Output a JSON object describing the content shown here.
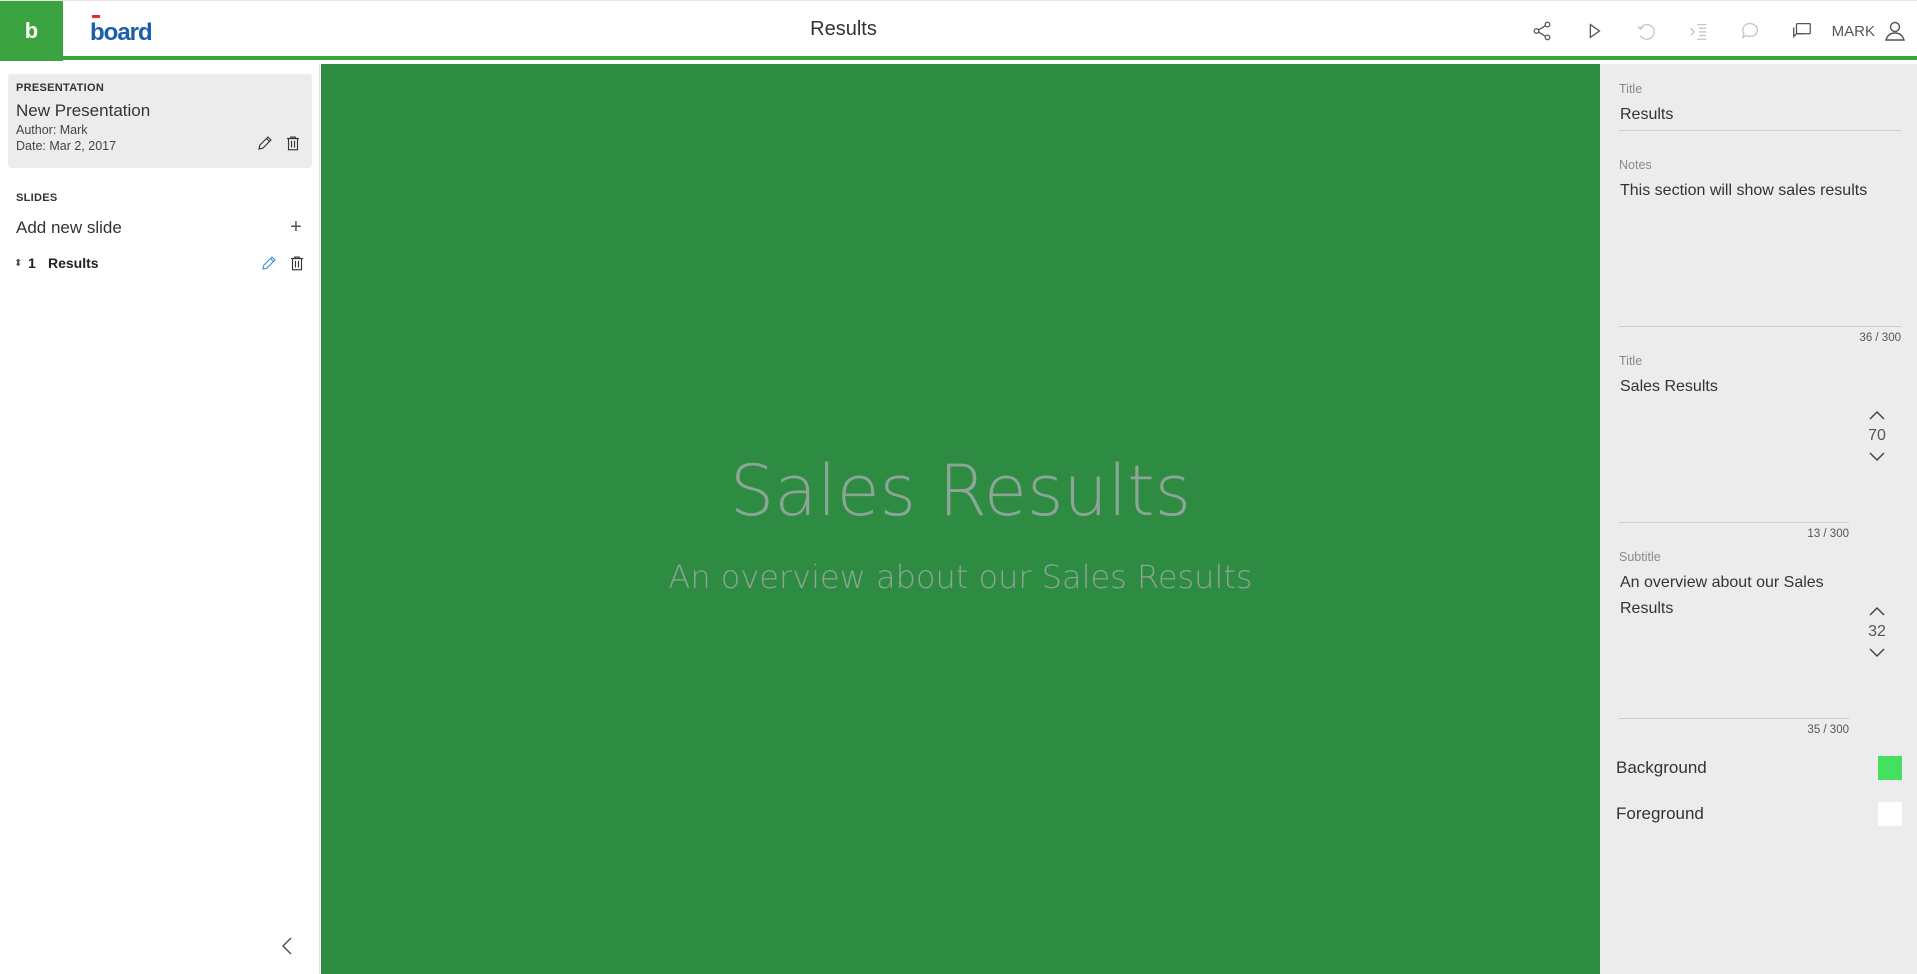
{
  "brand": {
    "square_letter": "b",
    "logo_text": "board"
  },
  "header": {
    "title": "Results",
    "user": "MARK"
  },
  "left": {
    "presentation_label": "PRESENTATION",
    "presentation_name": "New Presentation",
    "author": "Author: Mark",
    "date": "Date: Mar 2, 2017",
    "slides_label": "SLIDES",
    "add_slide_label": "Add new slide",
    "slides": [
      {
        "number": "1",
        "title": "Results"
      }
    ]
  },
  "slide": {
    "title": "Sales Results",
    "subtitle": "An overview about our Sales Results",
    "background": "#2e8b42",
    "text_color": "#8ca596"
  },
  "right": {
    "title_label": "Title",
    "title_value": "Results",
    "notes_label": "Notes",
    "notes_value": "This section will show sales results",
    "notes_counter": "36 / 300",
    "slide_title_label": "Title",
    "slide_title_value": "Sales Results",
    "slide_title_size": "70",
    "slide_title_counter": "13 / 300",
    "subtitle_label": "Subtitle",
    "subtitle_value": "An overview about our Sales Results",
    "subtitle_size": "32",
    "subtitle_counter": "35 / 300",
    "background_label": "Background",
    "background_color": "#44e060",
    "foreground_label": "Foreground",
    "foreground_color": "#ffffff"
  },
  "colors": {
    "accent": "#3aa33f",
    "panel": "#ececec"
  }
}
